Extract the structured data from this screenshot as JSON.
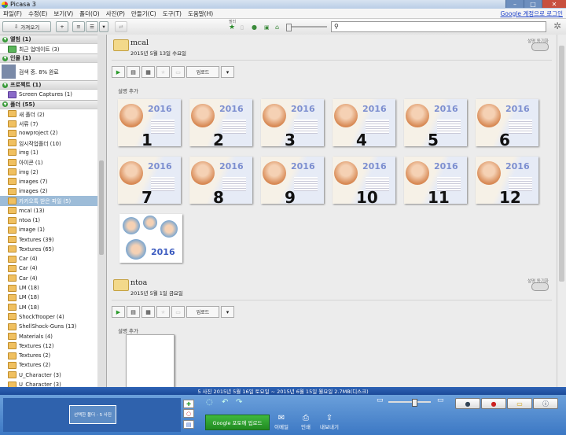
{
  "window": {
    "title": "Picasa 3"
  },
  "menu": {
    "items": [
      "파일(F)",
      "수정(E)",
      "보기(V)",
      "폴더(O)",
      "사진(P)",
      "만들기(C)",
      "도구(T)",
      "도움말(H)"
    ],
    "google_link": "Google 계정으로 로그인"
  },
  "toolbar": {
    "import_label": "가져오기",
    "filter_label": "필터"
  },
  "sidebar": {
    "sections": [
      {
        "title": "앨범 (1)",
        "items": [
          {
            "label": "최근 업데이트 (3)"
          }
        ]
      },
      {
        "title": "인물 (1)",
        "items": [
          {
            "label": "검색 중. 8% 완료"
          }
        ]
      },
      {
        "title": "프로젝트 (1)",
        "items": [
          {
            "label": "Screen Captures (1)"
          }
        ]
      },
      {
        "title": "폴더 (55)",
        "items": [
          {
            "label": "새 폴더 (2)"
          },
          {
            "label": "서류 (7)"
          },
          {
            "label": "nowproject (2)"
          },
          {
            "label": "임시작업폴더 (10)"
          },
          {
            "label": "img (1)"
          },
          {
            "label": "아이콘 (1)"
          },
          {
            "label": "img (2)"
          },
          {
            "label": "images (7)"
          },
          {
            "label": "images (2)"
          },
          {
            "label": "카카오톡 받은 파일 (5)",
            "selected": true
          },
          {
            "label": "mcal (13)"
          },
          {
            "label": "ntoa (1)"
          },
          {
            "label": "image (1)"
          },
          {
            "label": "Textures (39)"
          },
          {
            "label": "Textures (65)"
          },
          {
            "label": "Car (4)"
          },
          {
            "label": "Car (4)"
          },
          {
            "label": "Car (4)"
          },
          {
            "label": "LM (18)"
          },
          {
            "label": "LM (18)"
          },
          {
            "label": "LM (18)"
          },
          {
            "label": "ShockTrooper (4)"
          },
          {
            "label": "ShellShock-Guns (13)"
          },
          {
            "label": "Materials (4)"
          },
          {
            "label": "Textures (12)"
          },
          {
            "label": "Textures (2)"
          },
          {
            "label": "Textures (2)"
          },
          {
            "label": "U_Character (3)"
          },
          {
            "label": "U_Character (3)"
          }
        ]
      }
    ]
  },
  "albums": [
    {
      "name": "mcal",
      "date": "2015년 5월 13일 수요일",
      "share_label": "설명 동기화",
      "upload_label": "업로드",
      "desc_label": "설명 추가",
      "thumbs": [
        "1",
        "2",
        "3",
        "4",
        "5",
        "6",
        "7",
        "8",
        "9",
        "10",
        "11",
        "12"
      ],
      "year_text": "2016"
    },
    {
      "name": "ntoa",
      "date": "2015년 5월 1일 금요일",
      "share_label": "설명 동기화",
      "upload_label": "업로드",
      "desc_label": "설명 추가"
    }
  ],
  "status": {
    "text": "5 사진   2015년 5월 16일 토요일 ~ 2015년 6월 15일 월요일   2.7MB(디스크)"
  },
  "bottom": {
    "tray_label": "선택한 폴더 - 5 사진",
    "upload_btn": "Google 포토에 업로드",
    "actions": [
      "이메일",
      "인쇄",
      "내보내기"
    ]
  }
}
